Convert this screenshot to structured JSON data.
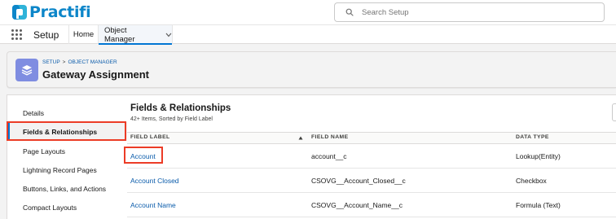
{
  "brand": {
    "name": "Practifi",
    "color": "#0d86c9"
  },
  "search": {
    "placeholder": "Search Setup"
  },
  "nav": {
    "app_name": "Setup",
    "tabs": [
      {
        "label": "Home"
      },
      {
        "label": "Object Manager",
        "active": true
      }
    ]
  },
  "header": {
    "breadcrumb": [
      "SETUP",
      "OBJECT MANAGER"
    ],
    "breadcrumb_separator": ">",
    "title": "Gateway Assignment",
    "icon": "layers-icon",
    "icon_color": "#7f8de1"
  },
  "sidebar": {
    "items": [
      {
        "label": "Details"
      },
      {
        "label": "Fields & Relationships",
        "active": true,
        "highlighted": true
      },
      {
        "label": "Page Layouts"
      },
      {
        "label": "Lightning Record Pages"
      },
      {
        "label": "Buttons, Links, and Actions"
      },
      {
        "label": "Compact Layouts"
      }
    ]
  },
  "main": {
    "title": "Fields & Relationships",
    "subtitle": "42+ Items, Sorted by Field Label",
    "columns": [
      "FIELD LABEL",
      "FIELD NAME",
      "DATA TYPE"
    ],
    "sort_icon": "sort-up-icon",
    "rows": [
      {
        "label": "Account",
        "name": "account__c",
        "type": "Lookup(Entity)",
        "highlighted": true
      },
      {
        "label": "Account Closed",
        "name": "CSOVG__Account_Closed__c",
        "type": "Checkbox"
      },
      {
        "label": "Account Name",
        "name": "CSOVG__Account_Name__c",
        "type": "Formula (Text)"
      }
    ]
  },
  "colors": {
    "highlight": "#ec3c26",
    "link": "#0b5cab",
    "accent": "#0176d3"
  }
}
